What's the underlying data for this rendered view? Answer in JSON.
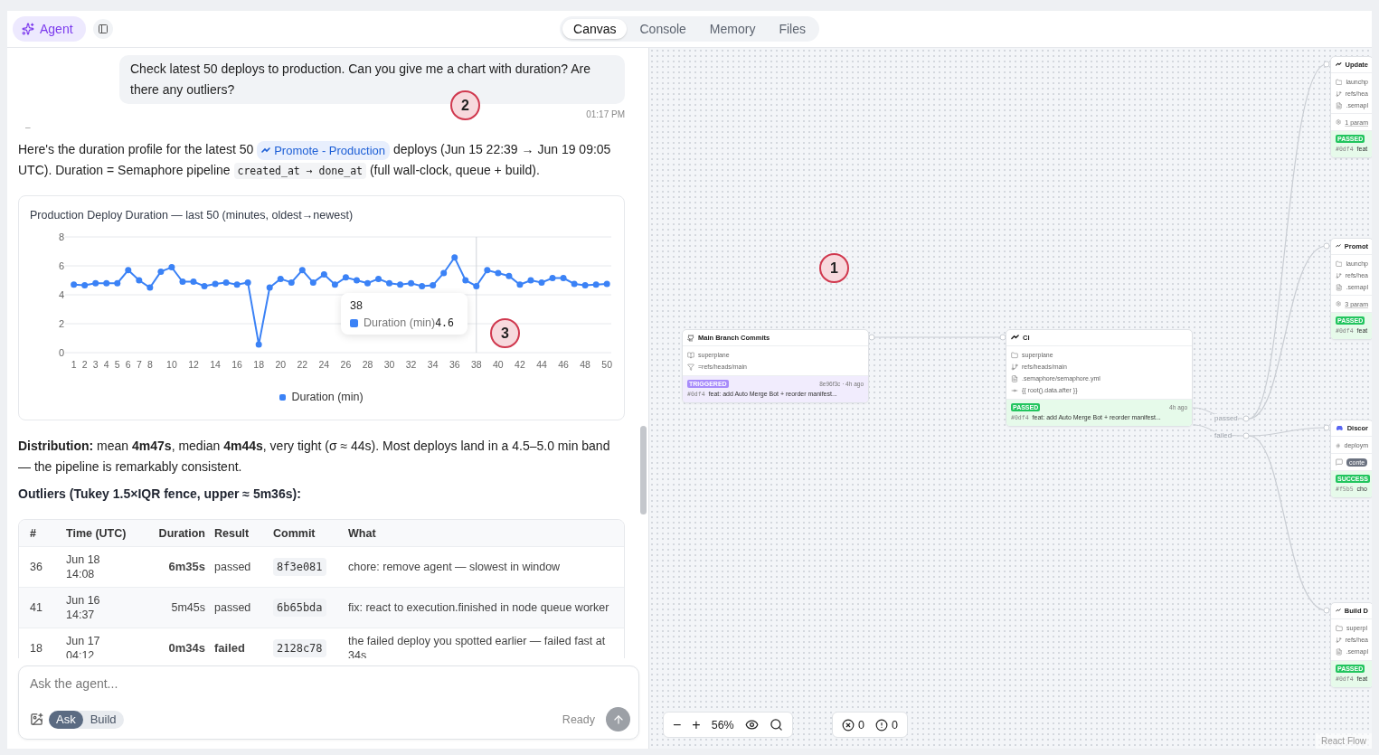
{
  "header": {
    "agent_button": "Agent",
    "tabs": [
      {
        "label": "Canvas",
        "selected": true
      },
      {
        "label": "Console",
        "selected": false
      },
      {
        "label": "Memory",
        "selected": false
      },
      {
        "label": "Files",
        "selected": false
      }
    ]
  },
  "chat": {
    "user_message": {
      "text": "Check latest 50 deploys to production. Can you give me a chart with duration? Are there any outliers?",
      "time": "01:17 PM"
    },
    "separator": "–",
    "intro": [
      {
        "kind": "text",
        "text": "Here's the duration profile for the latest 50 "
      },
      {
        "kind": "chip",
        "text": "Promote - Production"
      },
      {
        "kind": "text",
        "text": " deploys (Jun 15 22:39 → Jun 19 09:05 UTC). Duration = Semaphore pipeline "
      },
      {
        "kind": "code",
        "text": "created_at → done_at"
      },
      {
        "kind": "text",
        "text": " (full wall-clock, queue + build)."
      }
    ],
    "chart_data": {
      "type": "line",
      "title": "Production Deploy Duration — last 50 (minutes, oldest→newest)",
      "x": [
        1,
        2,
        3,
        4,
        5,
        6,
        7,
        8,
        9,
        10,
        11,
        12,
        13,
        14,
        15,
        16,
        17,
        18,
        19,
        20,
        21,
        22,
        23,
        24,
        25,
        26,
        27,
        28,
        29,
        30,
        31,
        32,
        33,
        34,
        35,
        36,
        37,
        38,
        39,
        40,
        41,
        42,
        43,
        44,
        45,
        46,
        47,
        48,
        49,
        50
      ],
      "grid": true,
      "ref_lines": [
        {
          "axis": "x",
          "value": 38
        }
      ],
      "series": [
        {
          "name": "Duration (min)",
          "color": "#3b82f6",
          "marker": "circle",
          "values": [
            4.7,
            4.65,
            4.8,
            4.8,
            4.8,
            5.7,
            5.0,
            4.5,
            5.6,
            5.9,
            4.9,
            4.9,
            4.6,
            4.75,
            4.85,
            4.7,
            4.85,
            0.57,
            4.5,
            5.1,
            4.85,
            5.7,
            4.85,
            5.4,
            4.7,
            5.2,
            5.0,
            4.8,
            5.1,
            4.8,
            4.7,
            4.8,
            4.6,
            4.65,
            5.5,
            6.58,
            5.0,
            4.6,
            5.7,
            5.5,
            5.3,
            4.7,
            5.0,
            4.85,
            5.15,
            5.15,
            4.75,
            4.65,
            4.7,
            4.75
          ]
        }
      ],
      "xlim": [
        0.2,
        50.4
      ],
      "ylim": [
        0,
        8
      ],
      "yticks": [
        0,
        2,
        4,
        6,
        8
      ],
      "xticks": [
        1,
        2,
        3,
        4,
        5,
        6,
        7,
        8,
        10,
        12,
        14,
        16,
        18,
        20,
        22,
        24,
        26,
        28,
        30,
        32,
        34,
        36,
        38,
        40,
        42,
        44,
        46,
        48,
        50
      ]
    },
    "tooltip": {
      "title": "38",
      "label": "Duration (min)",
      "value": "4.6"
    },
    "distribution": "**Distribution:** mean **4m47s**, median **4m44s**, very tight (σ ≈ 44s). Most deploys land in a 4.5–5.0 min band — the pipeline is remarkably consistent.",
    "outliers_heading": "Outliers (Tukey 1.5×IQR fence, upper ≈ 5m36s):",
    "table": {
      "columns": [
        "#",
        "Time (UTC)",
        "Duration",
        "Result",
        "Commit",
        "What"
      ],
      "rows": [
        {
          "index": "36",
          "time": "Jun 18 14:08",
          "duration": "6m35s",
          "duration_strong": true,
          "result": "passed",
          "result_strong": false,
          "commit": "8f3e081",
          "what": "chore: remove agent — slowest in window"
        },
        {
          "index": "41",
          "time": "Jun 16 14:37",
          "duration": "5m45s",
          "duration_strong": false,
          "result": "passed",
          "result_strong": false,
          "commit": "6b65bda",
          "what": "fix: react to execution.finished in node queue worker"
        },
        {
          "index": "18",
          "time": "Jun 17 04:12",
          "duration": "0m34s",
          "duration_strong": true,
          "result": "failed",
          "result_strong": true,
          "commit": "2128c78",
          "what": "the failed deploy you spotted earlier — failed fast at 34s"
        }
      ]
    },
    "composer": {
      "placeholder": "Ask the agent...",
      "modes": [
        {
          "label": "Ask",
          "selected": true
        },
        {
          "label": "Build",
          "selected": false
        }
      ],
      "status": "Ready"
    }
  },
  "canvas": {
    "nodes": [
      {
        "kind": "trigger",
        "title": "Main Branch Commits",
        "rows": [
          {
            "kind": "repo",
            "text": "superplane"
          },
          {
            "kind": "filter",
            "text": "=refs/heads/main"
          }
        ],
        "status": {
          "kind": "triggered",
          "badge": "TRIGGERED",
          "meta": "8e96f3c · 4h ago",
          "hash": "#0df4",
          "message": "feat: add Auto Merge Bot + reorder manifest..."
        }
      },
      {
        "kind": "pipeline",
        "title": "CI",
        "rows": [
          {
            "kind": "folder",
            "text": "superplane"
          },
          {
            "kind": "branch",
            "text": "refs/heads/main"
          },
          {
            "kind": "file",
            "text": ".semaphore/semaphore.yml"
          },
          {
            "kind": "input",
            "text": "{{ root().data.after }}"
          }
        ],
        "status": {
          "kind": "passed",
          "badge": "PASSED",
          "meta": "4h ago",
          "hash": "#0df4",
          "message": "feat: add Auto Merge Bot + reorder manifest..."
        },
        "outputs": [
          "passed",
          "failed"
        ]
      },
      {
        "kind": "pipeline",
        "title": "Update",
        "rows": [
          {
            "kind": "folder",
            "text": "launchp"
          },
          {
            "kind": "branch",
            "text": "refs/hea"
          },
          {
            "kind": "file",
            "text": ".semapl"
          },
          {
            "kind": "param",
            "text": "1 param"
          }
        ],
        "status": {
          "kind": "passed",
          "badge": "PASSED",
          "hash": "#0df4",
          "message": "feat"
        }
      },
      {
        "kind": "pipeline",
        "title": "Promot",
        "rows": [
          {
            "kind": "folder",
            "text": "launchp"
          },
          {
            "kind": "branch",
            "text": "refs/hea"
          },
          {
            "kind": "file",
            "text": ".semapl"
          },
          {
            "kind": "param",
            "text": "3 param"
          }
        ],
        "status": {
          "kind": "passed",
          "badge": "PASSED",
          "hash": "#0df4",
          "message": "feat"
        }
      },
      {
        "kind": "notify",
        "title": "Discor",
        "rows": [
          {
            "kind": "channel",
            "text": "deploym"
          },
          {
            "kind": "content",
            "text": "conte"
          }
        ],
        "status": {
          "kind": "success",
          "badge": "SUCCESS",
          "hash": "#f5b5",
          "message": "cho"
        }
      },
      {
        "kind": "pipeline",
        "title": "Build D",
        "rows": [
          {
            "kind": "folder",
            "text": "superpl"
          },
          {
            "kind": "branch",
            "text": "refs/hea"
          },
          {
            "kind": "file",
            "text": ".semapl"
          }
        ],
        "status": {
          "kind": "passed",
          "badge": "PASSED",
          "hash": "#0df4",
          "message": "feat"
        }
      }
    ],
    "zoom_out": "−",
    "zoom_in": "+",
    "zoom": "56%",
    "errors": "0",
    "warnings": "0",
    "attribution": "React Flow"
  },
  "callouts": [
    "1",
    "2",
    "3"
  ]
}
